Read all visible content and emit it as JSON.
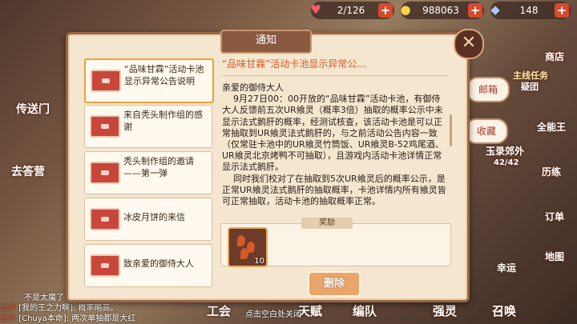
{
  "resources": {
    "stamina": "2/126",
    "gold": "988063",
    "gems": "148"
  },
  "left_menu": {
    "portal": "传送门",
    "back": "去答营"
  },
  "right_menu": {
    "shop": "商店",
    "mainline": "主线任务",
    "quest": "疑团",
    "mailbox": "邮箱",
    "favorites": "收藏",
    "fullfun": "全能王",
    "jade": "玉录郊外",
    "progress": "42/42",
    "levels": "历练",
    "order": "订单",
    "map": "地图"
  },
  "bottom_tabs": [
    "工会",
    "天赋",
    "编队",
    "强灵",
    "召唤"
  ],
  "bottom_extra": "幸运",
  "chat": [
    {
      "channel": "",
      "text": "不是太魔了"
    },
    {
      "channel": "世界",
      "text": "[我的王之力啊]: 概率略高。"
    },
    {
      "channel": "世界",
      "text": "[Chuya本命]: 两次单抽都是大红"
    }
  ],
  "dialog": {
    "title": "通知",
    "items": [
      {
        "title": "“品味甘霖”活动卡池显示异常公告说明",
        "selected": true
      },
      {
        "title": "来自秃头制作组的感谢",
        "selected": false
      },
      {
        "title": "秃头制作组的邀请——第一弹",
        "selected": false
      },
      {
        "title": "冰皮月饼的来信",
        "selected": false
      },
      {
        "title": "致亲爱的御侍大人",
        "selected": false
      }
    ],
    "content_title": "“品味甘霖”活动卡池显示异常公...",
    "content_body": "亲爱的御侍大人\n    9月27日00：00开放的“品味甘霖”活动卡池，有御侍大人反馈前五次UR飨灵（概率3倍）抽取的概率公示中未显示法式鹅肝的概率，经测试核查，该活动卡池是可以正常抽取到UR飨灵法式鹅肝的，与之前活动公告内容一致（仅常驻卡池中的UR飨灵竹筒饭、UR飨灵B-52鸡尾酒、UR飨灵北京烤鸭不可抽取），且游戏内活动卡池详情正常显示法式鹅肝。\n    同时我们校对了在抽取到5次UR飨灵后的概率公示，是正常UR飨灵法式鹅肝的抽取概率，卡池详情内所有飨灵皆可正常抽取，活动卡池的抽取概率正常。",
    "reward_label": "奖励",
    "reward_count": "10",
    "delete": "删除",
    "close_hint": "点击空白处关闭"
  }
}
